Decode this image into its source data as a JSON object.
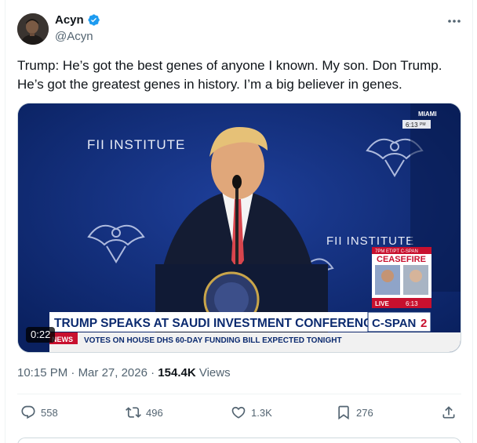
{
  "author": {
    "display_name": "Acyn",
    "handle": "@Acyn",
    "verified_icon": "verified-badge-icon"
  },
  "tweet": {
    "text": "Trump: He’s got the best genes of anyone I known. My son. Don Trump. He’s got the greatest genes in history. I’m a big believer in genes."
  },
  "video": {
    "duration": "0:22",
    "overlay": {
      "institute_label": "FII INSTITUTE",
      "location": "MIAMI",
      "local_time": "6:13",
      "local_time_suffix": "PM",
      "chyron_headline": "TRUMP SPEAKS AT SAUDI INVESTMENT CONFERENCE",
      "network": "C-SPAN",
      "network_number": "2",
      "ticker_prefix": "NEWS",
      "ticker_text": "VOTES ON HOUSE DHS 60-DAY FUNDING BILL EXPECTED TONIGHT",
      "live_label": "LIVE",
      "live_time": "6:13",
      "inset_schedule": "7PM ET/PT C-SPAN",
      "inset_title": "CEASEFIRE",
      "podium_seal_text": "SEAL OF THE PRESIDENT OF THE UNITED STATES"
    }
  },
  "meta": {
    "time": "10:15 PM",
    "separator": "·",
    "date": "Mar 27, 2026",
    "views_count": "154.4K",
    "views_label": "Views"
  },
  "actions": {
    "replies": "558",
    "reposts": "496",
    "likes": "1.3K",
    "bookmarks": "276"
  },
  "colors": {
    "text_primary": "#0f1419",
    "text_secondary": "#536471",
    "verified_blue": "#1d9bf0",
    "stage_blue": "#0e2a74",
    "chyron_red": "#c8102e"
  }
}
